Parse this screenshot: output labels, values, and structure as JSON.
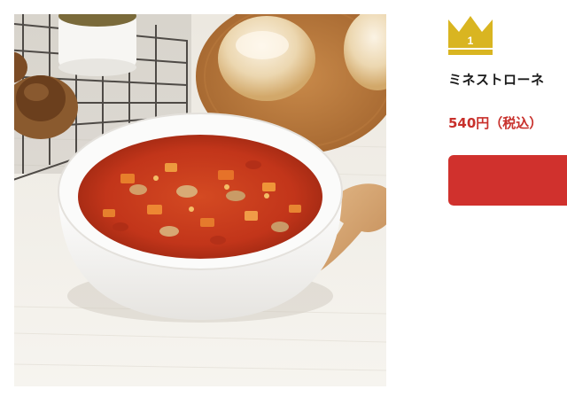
{
  "product": {
    "rank": "1",
    "name": "ミネストローネ",
    "price": "540円（税込）",
    "image_alt": "ミネストローネ"
  },
  "icons": {
    "rank": "crown-icon"
  },
  "colors": {
    "accent": "#d0312d",
    "price": "#c8302b",
    "crown": "#d9b521"
  }
}
